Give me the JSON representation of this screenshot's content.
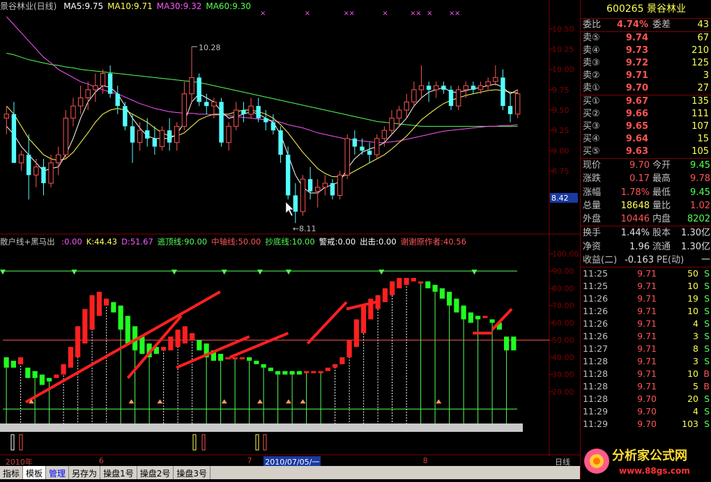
{
  "main_panel": {
    "title": "景谷林业(日线)",
    "ma_labels": [
      {
        "text": "MA5:9.75",
        "color": "#ffffff"
      },
      {
        "text": "MA10:9.71",
        "color": "#ffff54"
      },
      {
        "text": "MA30:9.32",
        "color": "#ff54ff"
      },
      {
        "text": "MA60:9.30",
        "color": "#54ff54"
      }
    ],
    "y_ticks": [
      "10.50",
      "10.25",
      "10.00",
      "9.75",
      "9.50",
      "9.25",
      "9.00",
      "8.75"
    ],
    "high_label": "10.28",
    "low_label": "←8.11",
    "current_price_tag": "8.42"
  },
  "indicator_panel": {
    "title": "散户线+黑马出",
    "values": [
      {
        "text": ":0.00",
        "color": "#ff54ff"
      },
      {
        "text": "K:44.43",
        "color": "#ffff54"
      },
      {
        "text": "D:51.67",
        "color": "#ff54ff"
      },
      {
        "text": "逃顶线:90.00",
        "color": "#54ff54"
      },
      {
        "text": "中轴线:50.00",
        "color": "#ff5454"
      },
      {
        "text": "抄底线:10.00",
        "color": "#54ff54"
      },
      {
        "text": "警戒:0.00",
        "color": "#ffffff"
      },
      {
        "text": "出击:0.00",
        "color": "#ffffff"
      },
      {
        "text": "谢谢原作者:40.56",
        "color": "#ff5454"
      }
    ],
    "y_ticks": [
      "100.00",
      "90.00",
      "80.00",
      "70.00",
      "60.00",
      "50.00",
      "40.00",
      "30.00",
      "20.00"
    ]
  },
  "chart_data": {
    "type": "candlestick",
    "ylim": [
      8.0,
      10.7
    ],
    "candles": [
      [
        9.4,
        9.55,
        9.2,
        9.45
      ],
      [
        9.45,
        9.6,
        8.9,
        8.85
      ],
      [
        8.85,
        9.0,
        8.75,
        8.95
      ],
      [
        8.95,
        9.2,
        8.4,
        8.7
      ],
      [
        8.7,
        8.9,
        8.55,
        8.8
      ],
      [
        8.8,
        8.9,
        8.45,
        8.6
      ],
      [
        8.6,
        8.95,
        8.55,
        8.85
      ],
      [
        8.85,
        9.05,
        8.7,
        8.95
      ],
      [
        8.95,
        9.5,
        8.9,
        9.4
      ],
      [
        9.4,
        9.65,
        9.3,
        9.55
      ],
      [
        9.55,
        9.8,
        9.45,
        9.65
      ],
      [
        9.65,
        9.85,
        9.5,
        9.75
      ],
      [
        9.75,
        9.95,
        9.6,
        9.8
      ],
      [
        9.8,
        10.0,
        9.7,
        9.95
      ],
      [
        9.95,
        10.05,
        9.65,
        9.7
      ],
      [
        9.7,
        9.8,
        9.45,
        9.55
      ],
      [
        9.55,
        9.6,
        9.25,
        9.3
      ],
      [
        9.3,
        9.45,
        8.85,
        9.1
      ],
      [
        9.1,
        9.35,
        9.0,
        9.25
      ],
      [
        9.25,
        9.4,
        9.05,
        9.15
      ],
      [
        9.15,
        9.3,
        8.95,
        9.05
      ],
      [
        9.05,
        9.3,
        9.0,
        9.25
      ],
      [
        9.25,
        9.4,
        9.0,
        9.1
      ],
      [
        9.1,
        9.35,
        9.0,
        9.3
      ],
      [
        9.3,
        9.85,
        9.25,
        9.7
      ],
      [
        9.7,
        10.28,
        9.6,
        9.9
      ],
      [
        9.9,
        9.95,
        9.55,
        9.6
      ],
      [
        9.6,
        9.7,
        9.45,
        9.55
      ],
      [
        9.55,
        9.65,
        9.4,
        9.6
      ],
      [
        9.6,
        9.65,
        9.05,
        9.1
      ],
      [
        9.1,
        9.35,
        9.0,
        9.3
      ],
      [
        9.3,
        9.6,
        9.25,
        9.5
      ],
      [
        9.5,
        9.6,
        9.35,
        9.45
      ],
      [
        9.45,
        9.65,
        9.4,
        9.55
      ],
      [
        9.55,
        9.65,
        9.35,
        9.4
      ],
      [
        9.4,
        9.5,
        9.25,
        9.35
      ],
      [
        9.35,
        9.45,
        9.2,
        9.25
      ],
      [
        9.25,
        9.3,
        8.85,
        8.95
      ],
      [
        8.95,
        9.05,
        8.4,
        8.45
      ],
      [
        8.45,
        8.6,
        8.11,
        8.25
      ],
      [
        8.25,
        8.7,
        8.2,
        8.65
      ],
      [
        8.65,
        8.8,
        8.4,
        8.5
      ],
      [
        8.5,
        8.65,
        8.3,
        8.55
      ],
      [
        8.55,
        8.7,
        8.45,
        8.6
      ],
      [
        8.6,
        8.65,
        8.4,
        8.45
      ],
      [
        8.45,
        8.75,
        8.4,
        8.7
      ],
      [
        8.7,
        9.2,
        8.65,
        9.15
      ],
      [
        9.15,
        9.25,
        8.95,
        9.05
      ],
      [
        9.05,
        9.15,
        8.95,
        9.0
      ],
      [
        9.0,
        9.1,
        8.85,
        8.95
      ],
      [
        8.95,
        9.2,
        8.9,
        9.15
      ],
      [
        9.15,
        9.3,
        9.05,
        9.25
      ],
      [
        9.25,
        9.5,
        9.2,
        9.4
      ],
      [
        9.4,
        9.55,
        9.3,
        9.5
      ],
      [
        9.5,
        9.7,
        9.4,
        9.6
      ],
      [
        9.6,
        9.85,
        9.55,
        9.75
      ],
      [
        9.75,
        10.05,
        9.65,
        9.8
      ],
      [
        9.8,
        9.85,
        9.6,
        9.75
      ],
      [
        9.75,
        9.85,
        9.65,
        9.8
      ],
      [
        9.8,
        9.85,
        9.7,
        9.75
      ],
      [
        9.75,
        9.8,
        9.5,
        9.55
      ],
      [
        9.55,
        9.8,
        9.5,
        9.75
      ],
      [
        9.75,
        9.85,
        9.65,
        9.8
      ],
      [
        9.8,
        9.85,
        9.7,
        9.75
      ],
      [
        9.75,
        9.85,
        9.7,
        9.8
      ],
      [
        9.8,
        9.9,
        9.75,
        9.85
      ],
      [
        9.85,
        10.05,
        9.8,
        9.9
      ],
      [
        9.9,
        10.0,
        9.5,
        9.55
      ],
      [
        9.55,
        9.7,
        9.35,
        9.45
      ],
      [
        9.45,
        9.75,
        9.4,
        9.7
      ]
    ],
    "ma5_approx": [
      9.3,
      9.2,
      9.05,
      8.95,
      8.85,
      8.75,
      8.78,
      8.8,
      8.95,
      9.15,
      9.4,
      9.6,
      9.72,
      9.8,
      9.78,
      9.7,
      9.55,
      9.4,
      9.28,
      9.18,
      9.15,
      9.15,
      9.15,
      9.2,
      9.35,
      9.6,
      9.7,
      9.65,
      9.6,
      9.48,
      9.4,
      9.42,
      9.45,
      9.48,
      9.45,
      9.4,
      9.35,
      9.2,
      8.95,
      8.7,
      8.55,
      8.48,
      8.48,
      8.55,
      8.58,
      8.62,
      8.78,
      8.9,
      8.98,
      9.02,
      9.05,
      9.1,
      9.2,
      9.3,
      9.4,
      9.55,
      9.65,
      9.72,
      9.75,
      9.78,
      9.72,
      9.72,
      9.74,
      9.76,
      9.78,
      9.8,
      9.82,
      9.78,
      9.7,
      9.75
    ],
    "ma10_approx": [
      9.55,
      9.45,
      9.3,
      9.15,
      9.05,
      8.95,
      8.9,
      8.88,
      8.9,
      8.98,
      9.1,
      9.22,
      9.35,
      9.45,
      9.5,
      9.52,
      9.5,
      9.45,
      9.4,
      9.35,
      9.28,
      9.22,
      9.18,
      9.18,
      9.22,
      9.3,
      9.38,
      9.42,
      9.45,
      9.45,
      9.45,
      9.48,
      9.5,
      9.5,
      9.48,
      9.45,
      9.4,
      9.32,
      9.22,
      9.1,
      8.98,
      8.88,
      8.78,
      8.72,
      8.68,
      8.68,
      8.7,
      8.75,
      8.8,
      8.85,
      8.9,
      8.95,
      9.02,
      9.1,
      9.18,
      9.28,
      9.38,
      9.45,
      9.52,
      9.58,
      9.62,
      9.65,
      9.68,
      9.7,
      9.72,
      9.74,
      9.75,
      9.74,
      9.72,
      9.71
    ],
    "ma30_approx": [
      10.65,
      10.55,
      10.45,
      10.35,
      10.25,
      10.15,
      10.08,
      10.0,
      9.95,
      9.9,
      9.85,
      9.82,
      9.78,
      9.75,
      9.72,
      9.7,
      9.66,
      9.62,
      9.58,
      9.55,
      9.52,
      9.5,
      9.48,
      9.47,
      9.46,
      9.46,
      9.45,
      9.45,
      9.44,
      9.44,
      9.43,
      9.42,
      9.41,
      9.4,
      9.39,
      9.38,
      9.37,
      9.35,
      9.32,
      9.3,
      9.28,
      9.25,
      9.22,
      9.2,
      9.18,
      9.16,
      9.14,
      9.13,
      9.12,
      9.11,
      9.1,
      9.1,
      9.11,
      9.12,
      9.14,
      9.16,
      9.18,
      9.2,
      9.22,
      9.24,
      9.25,
      9.26,
      9.27,
      9.28,
      9.29,
      9.3,
      9.3,
      9.31,
      9.31,
      9.32
    ],
    "ma60_approx": [
      10.2,
      10.18,
      10.15,
      10.12,
      10.1,
      10.08,
      10.06,
      10.05,
      10.03,
      10.02,
      10.0,
      9.99,
      9.98,
      9.97,
      9.96,
      9.95,
      9.94,
      9.93,
      9.92,
      9.91,
      9.9,
      9.89,
      9.88,
      9.87,
      9.86,
      9.85,
      9.84,
      9.82,
      9.8,
      9.78,
      9.76,
      9.74,
      9.72,
      9.7,
      9.68,
      9.66,
      9.64,
      9.62,
      9.6,
      9.58,
      9.56,
      9.54,
      9.52,
      9.5,
      9.48,
      9.46,
      9.44,
      9.42,
      9.4,
      9.38,
      9.36,
      9.35,
      9.34,
      9.33,
      9.32,
      9.31,
      9.3,
      9.3,
      9.3,
      9.3,
      9.3,
      9.3,
      9.3,
      9.3,
      9.3,
      9.3,
      9.3,
      9.3,
      9.3,
      9.3
    ],
    "indicator": {
      "ylim": [
        0,
        105
      ],
      "k": [
        34,
        34,
        40,
        28,
        28,
        24,
        26,
        30,
        36,
        46,
        58,
        68,
        76,
        78,
        74,
        66,
        56,
        48,
        44,
        42,
        40,
        42,
        46,
        52,
        56,
        58,
        54,
        44,
        40,
        38,
        38,
        40,
        40,
        40,
        38,
        36,
        34,
        32,
        30,
        30,
        30,
        30,
        32,
        32,
        32,
        34,
        36,
        40,
        50,
        62,
        70,
        74,
        76,
        80,
        84,
        86,
        86,
        86,
        84,
        80,
        78,
        74,
        70,
        66,
        62,
        60,
        62,
        64,
        60,
        56,
        44,
        44
      ],
      "d": [
        40,
        38,
        36,
        34,
        32,
        30,
        28,
        28,
        30,
        34,
        40,
        48,
        56,
        64,
        70,
        72,
        70,
        64,
        58,
        52,
        48,
        46,
        44,
        44,
        46,
        48,
        50,
        50,
        48,
        44,
        42,
        40,
        40,
        40,
        40,
        38,
        36,
        34,
        32,
        32,
        32,
        32,
        32,
        32,
        32,
        32,
        34,
        36,
        40,
        46,
        54,
        62,
        68,
        72,
        76,
        80,
        82,
        84,
        84,
        84,
        82,
        80,
        78,
        74,
        70,
        66,
        64,
        64,
        62,
        60,
        52,
        52
      ],
      "line_a": [
        null,
        null,
        null,
        null,
        null,
        null,
        null,
        null,
        null,
        null,
        null,
        null,
        null,
        null,
        null,
        null,
        null,
        null,
        null,
        null,
        null,
        null,
        null,
        null,
        null,
        null,
        null,
        null,
        null,
        null,
        null,
        null,
        null,
        null,
        null,
        null,
        null,
        null,
        null,
        null,
        null,
        null,
        null,
        null,
        null,
        null,
        null,
        null,
        null,
        null,
        null,
        null,
        null,
        null,
        null,
        null,
        null,
        null,
        null,
        null,
        null,
        null,
        null,
        null,
        null,
        null,
        null,
        null,
        null,
        null,
        null,
        null
      ],
      "top_line": 90,
      "mid_line": 50,
      "bottom_line": 10,
      "top_arrows_x": [
        0,
        10,
        24,
        31,
        36,
        40,
        53,
        66
      ],
      "bottom_arrows_x": [
        4,
        18,
        22,
        31,
        36,
        40,
        42,
        61
      ]
    }
  },
  "x_axis": {
    "labels": [
      {
        "text": "2010年",
        "pos": 0.01
      },
      {
        "text": "6",
        "pos": 0.18
      },
      {
        "text": "7",
        "pos": 0.45
      },
      {
        "text": "2010/07/05/一",
        "pos": 0.48
      },
      {
        "text": "8",
        "pos": 0.77
      }
    ],
    "period": "日线"
  },
  "tabs": [
    {
      "label": "指标",
      "active": false
    },
    {
      "label": "模板",
      "active": true
    },
    {
      "label": "管理",
      "active": false,
      "blue": true
    },
    {
      "label": "另存为",
      "active": false
    },
    {
      "label": "操盘1号",
      "active": false
    },
    {
      "label": "操盘2号",
      "active": false
    },
    {
      "label": "操盘3号",
      "active": false
    }
  ],
  "quote_panel": {
    "code_name": "600265 景谷林业",
    "weibi": {
      "label": "委比",
      "value": "4.74%",
      "label2": "委差",
      "value2": "43"
    },
    "sells": [
      {
        "label": "卖⑤",
        "price": "9.74",
        "vol": "67"
      },
      {
        "label": "卖④",
        "price": "9.73",
        "vol": "210"
      },
      {
        "label": "卖③",
        "price": "9.72",
        "vol": "125"
      },
      {
        "label": "卖②",
        "price": "9.71",
        "vol": "3"
      },
      {
        "label": "卖①",
        "price": "9.70",
        "vol": "27"
      }
    ],
    "buys": [
      {
        "label": "买①",
        "price": "9.67",
        "vol": "135"
      },
      {
        "label": "买②",
        "price": "9.66",
        "vol": "111"
      },
      {
        "label": "买③",
        "price": "9.65",
        "vol": "107"
      },
      {
        "label": "买④",
        "price": "9.64",
        "vol": "15"
      },
      {
        "label": "买⑤",
        "price": "9.63",
        "vol": "105"
      }
    ],
    "stats": [
      {
        "l1": "现价",
        "v1": "9.70",
        "c1": "#ff5454",
        "l2": "今开",
        "v2": "9.45",
        "c2": "#54ff54"
      },
      {
        "l1": "涨跌",
        "v1": "0.17",
        "c1": "#ff5454",
        "l2": "最高",
        "v2": "9.78",
        "c2": "#ff5454"
      },
      {
        "l1": "涨幅",
        "v1": "1.78%",
        "c1": "#ff5454",
        "l2": "最低",
        "v2": "9.45",
        "c2": "#54ff54"
      },
      {
        "l1": "总量",
        "v1": "18648",
        "c1": "#ffff54",
        "l2": "量比",
        "v2": "1.02",
        "c2": "#ff5454"
      },
      {
        "l1": "外盘",
        "v1": "10446",
        "c1": "#ff5454",
        "l2": "内盘",
        "v2": "8202",
        "c2": "#54ff54"
      }
    ],
    "stats2": [
      {
        "l1": "换手",
        "v1": "1.44%",
        "c1": "#e0e0e0",
        "l2": "股本",
        "v2": "1.30亿",
        "c2": "#e0e0e0"
      },
      {
        "l1": "净资",
        "v1": "1.96",
        "c1": "#e0e0e0",
        "l2": "流通",
        "v2": "1.30亿",
        "c2": "#e0e0e0"
      },
      {
        "l1": "收益(二)",
        "v1": "-0.163",
        "c1": "#e0e0e0",
        "l2": "PE(动)",
        "v2": "一",
        "c2": "#e0e0e0"
      }
    ],
    "ticks": [
      {
        "time": "11:25",
        "price": "9.71",
        "vol": "50",
        "flag": "S"
      },
      {
        "time": "11:25",
        "price": "9.71",
        "vol": "10",
        "flag": "S"
      },
      {
        "time": "11:26",
        "price": "9.71",
        "vol": "19",
        "flag": "S"
      },
      {
        "time": "11:26",
        "price": "9.71",
        "vol": "10",
        "flag": "S"
      },
      {
        "time": "11:26",
        "price": "9.71",
        "vol": "4",
        "flag": "S"
      },
      {
        "time": "11:26",
        "price": "9.71",
        "vol": "3",
        "flag": "S"
      },
      {
        "time": "11:27",
        "price": "9.71",
        "vol": "8",
        "flag": "S"
      },
      {
        "time": "11:28",
        "price": "9.71",
        "vol": "3",
        "flag": "S"
      },
      {
        "time": "11:28",
        "price": "9.71",
        "vol": "10",
        "flag": "B"
      },
      {
        "time": "11:28",
        "price": "9.71",
        "vol": "5",
        "flag": "B"
      },
      {
        "time": "11:28",
        "price": "9.70",
        "vol": "20",
        "flag": "S"
      },
      {
        "time": "11:29",
        "price": "9.70",
        "vol": "4",
        "flag": "S"
      },
      {
        "time": "11:29",
        "price": "9.70",
        "vol": "103",
        "flag": "S"
      }
    ]
  },
  "watermark": {
    "title": "分析家公式网",
    "url": "www.88gs.com"
  }
}
